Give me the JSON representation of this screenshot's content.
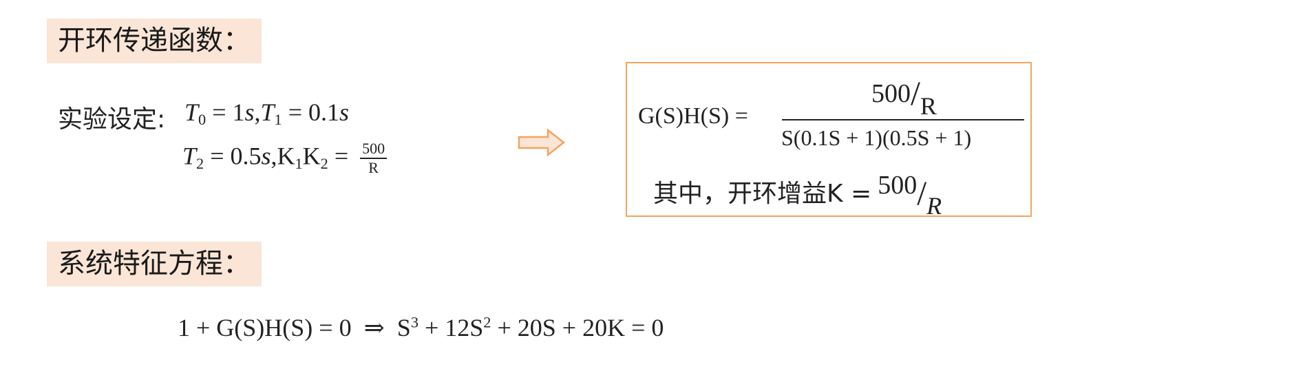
{
  "headings": {
    "open_loop": "开环传递函数：",
    "characteristic": "系统特征方程："
  },
  "settings": {
    "label": "实验设定:",
    "t0_sym": "T",
    "t0_sub": "0",
    "t0_eq": " = 1",
    "t0_unit": "s",
    "comma1": ",",
    "t1_sym": "T",
    "t1_sub": "1",
    "t1_eq": " = 0.1",
    "t1_unit": "s",
    "t2_sym": "T",
    "t2_sub": "2",
    "t2_eq": " = 0.5",
    "t2_unit": "s",
    "comma2": ",",
    "k1_sym": "K",
    "k1_sub": "1",
    "k2_sym": "K",
    "k2_sub": "2",
    "k_eq": " = ",
    "frac_num": "500",
    "frac_den": "R"
  },
  "formula": {
    "lhs": "G(S)H(S) =",
    "numerator": "500",
    "slash": "/",
    "numerator_den": "R",
    "denominator": "S(0.1S + 1)(0.5S + 1)",
    "gain_label": "其中，开环增益K =",
    "gain_num": "500",
    "gain_slash": "/",
    "gain_den": "R"
  },
  "equation": {
    "left": "1 + G(S)H(S) = 0",
    "implies": "⇒",
    "s3": "S",
    "s3_exp": "3",
    "mid": " + 12S",
    "s2_exp": "2",
    "rest": " + 20S + 20K =  0"
  },
  "colors": {
    "heading_bg": "#fbe5d6",
    "accent_orange": "#f4a460",
    "text": "#222222"
  }
}
